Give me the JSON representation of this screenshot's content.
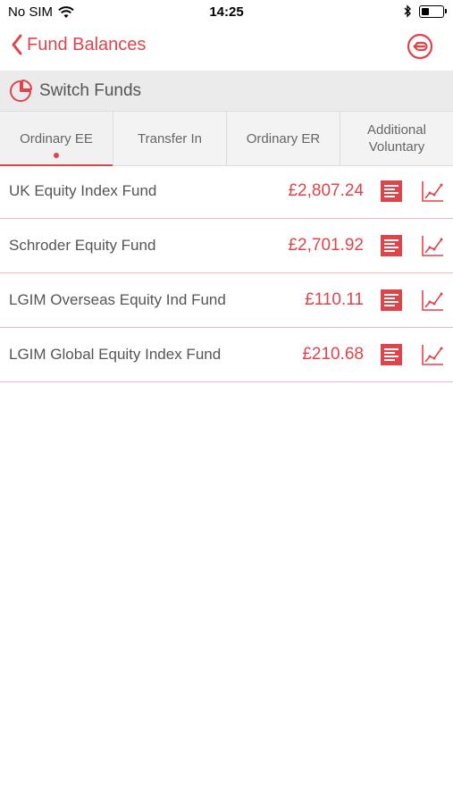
{
  "status_bar": {
    "carrier": "No SIM",
    "time": "14:25",
    "battery_level": 0.35
  },
  "nav": {
    "back_label": "Fund Balances"
  },
  "switch_funds": {
    "label": "Switch Funds"
  },
  "tabs": [
    {
      "label": "Ordinary EE",
      "active": true
    },
    {
      "label": "Transfer In",
      "active": false
    },
    {
      "label": "Ordinary ER",
      "active": false
    },
    {
      "label": "Additional Voluntary",
      "active": false
    }
  ],
  "funds": [
    {
      "name": "UK Equity Index Fund",
      "value": "£2,807.24"
    },
    {
      "name": "Schroder Equity Fund",
      "value": "£2,701.92"
    },
    {
      "name": "LGIM Overseas Equity Ind Fund",
      "value": "£110.11"
    },
    {
      "name": "LGIM Global Equity Index Fund",
      "value": "£210.68"
    }
  ],
  "colors": {
    "accent": "#e0444b",
    "divider": "#f0b9bc",
    "header_bg": "#ebebeb"
  }
}
